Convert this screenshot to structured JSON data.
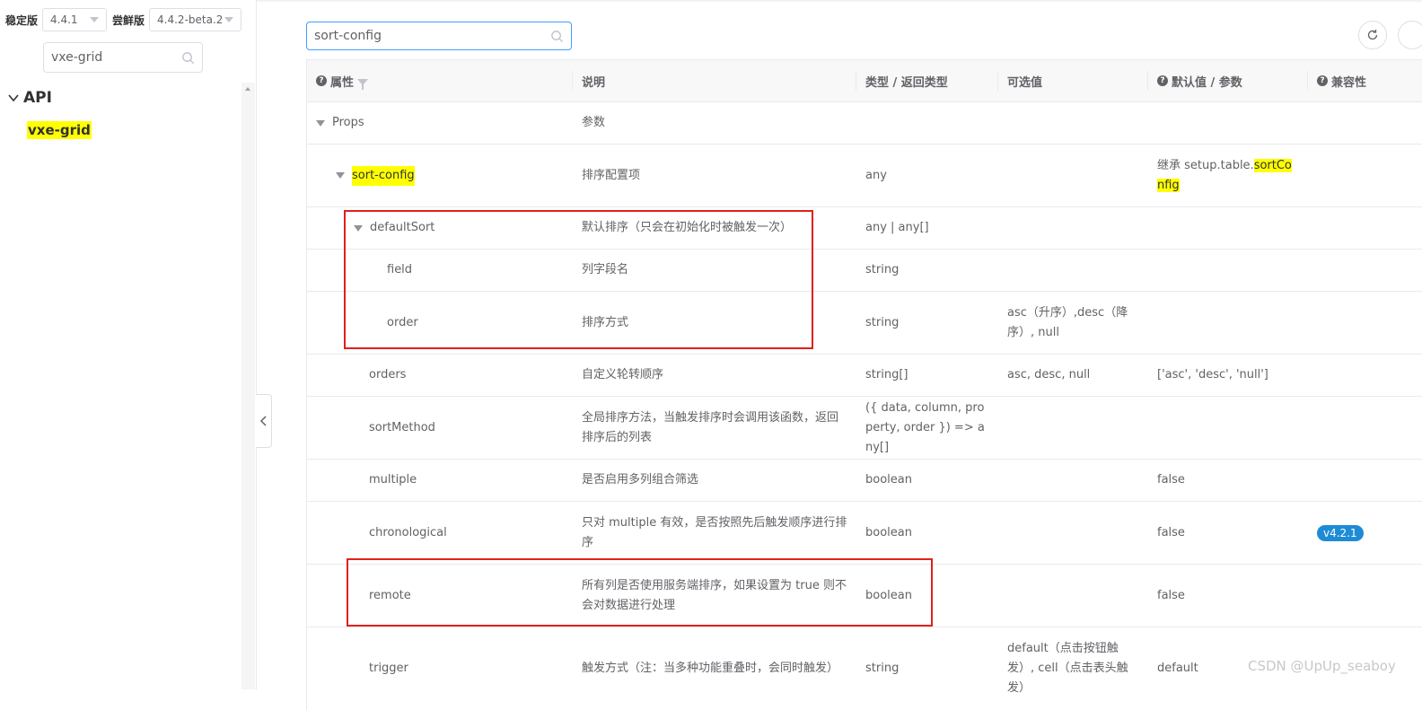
{
  "sidebar": {
    "stable_label": "稳定版",
    "stable_version": "4.4.1",
    "beta_label": "尝鲜版",
    "beta_version": "4.4.2-beta.2",
    "search_value": "vxe-grid",
    "tree_root": "API",
    "tree_child": "vxe-grid"
  },
  "search": {
    "value": "sort-config"
  },
  "table": {
    "headers": {
      "prop": "属性",
      "desc": "说明",
      "type": "类型 / 返回类型",
      "options": "可选值",
      "default": "默认值 / 参数",
      "compat": "兼容性"
    },
    "rows": [
      {
        "name": "Props",
        "desc": "参数",
        "type": "",
        "options": "",
        "default": "",
        "compat": ""
      },
      {
        "name": "sort-config",
        "desc": "排序配置项",
        "type": "any",
        "options": "",
        "default_prefix": "继承 setup.table.",
        "default_hl": "sortConfig",
        "compat": ""
      },
      {
        "name": "defaultSort",
        "desc": "默认排序（只会在初始化时被触发一次）",
        "type": "any | any[]",
        "options": "",
        "default": "",
        "compat": ""
      },
      {
        "name": "field",
        "desc": "列字段名",
        "type": "string",
        "options": "",
        "default": "",
        "compat": ""
      },
      {
        "name": "order",
        "desc": "排序方式",
        "type": "string",
        "options": "asc（升序）,desc（降序）, null",
        "default": "",
        "compat": ""
      },
      {
        "name": "orders",
        "desc": "自定义轮转顺序",
        "type": "string[]",
        "options": "asc, desc, null",
        "default": "['asc', 'desc', 'null']",
        "compat": ""
      },
      {
        "name": "sortMethod",
        "desc": "全局排序方法，当触发排序时会调用该函数，返回排序后的列表",
        "type": "({ data, column, property, order }) => any[]",
        "options": "",
        "default": "",
        "compat": ""
      },
      {
        "name": "multiple",
        "desc": "是否启用多列组合筛选",
        "type": "boolean",
        "options": "",
        "default": "false",
        "compat": ""
      },
      {
        "name": "chronological",
        "desc": "只对 multiple 有效，是否按照先后触发顺序进行排序",
        "type": "boolean",
        "options": "",
        "default": "false",
        "compat": "v4.2.1"
      },
      {
        "name": "remote",
        "desc": "所有列是否使用服务端排序，如果设置为 true 则不会对数据进行处理",
        "type": "boolean",
        "options": "",
        "default": "false",
        "compat": ""
      },
      {
        "name": "trigger",
        "desc": "触发方式（注：当多种功能重叠时，会同时触发）",
        "type": "string",
        "options": "default（点击按钮触发）, cell（点击表头触发）",
        "default": "default",
        "compat": ""
      }
    ]
  },
  "watermark": "CSDN @UpUp_seaboy",
  "colors": {
    "highlight": "#ffff00",
    "annotation_red": "#e0201b",
    "badge_blue": "#1e8bd6",
    "focus_blue": "#409eff"
  }
}
